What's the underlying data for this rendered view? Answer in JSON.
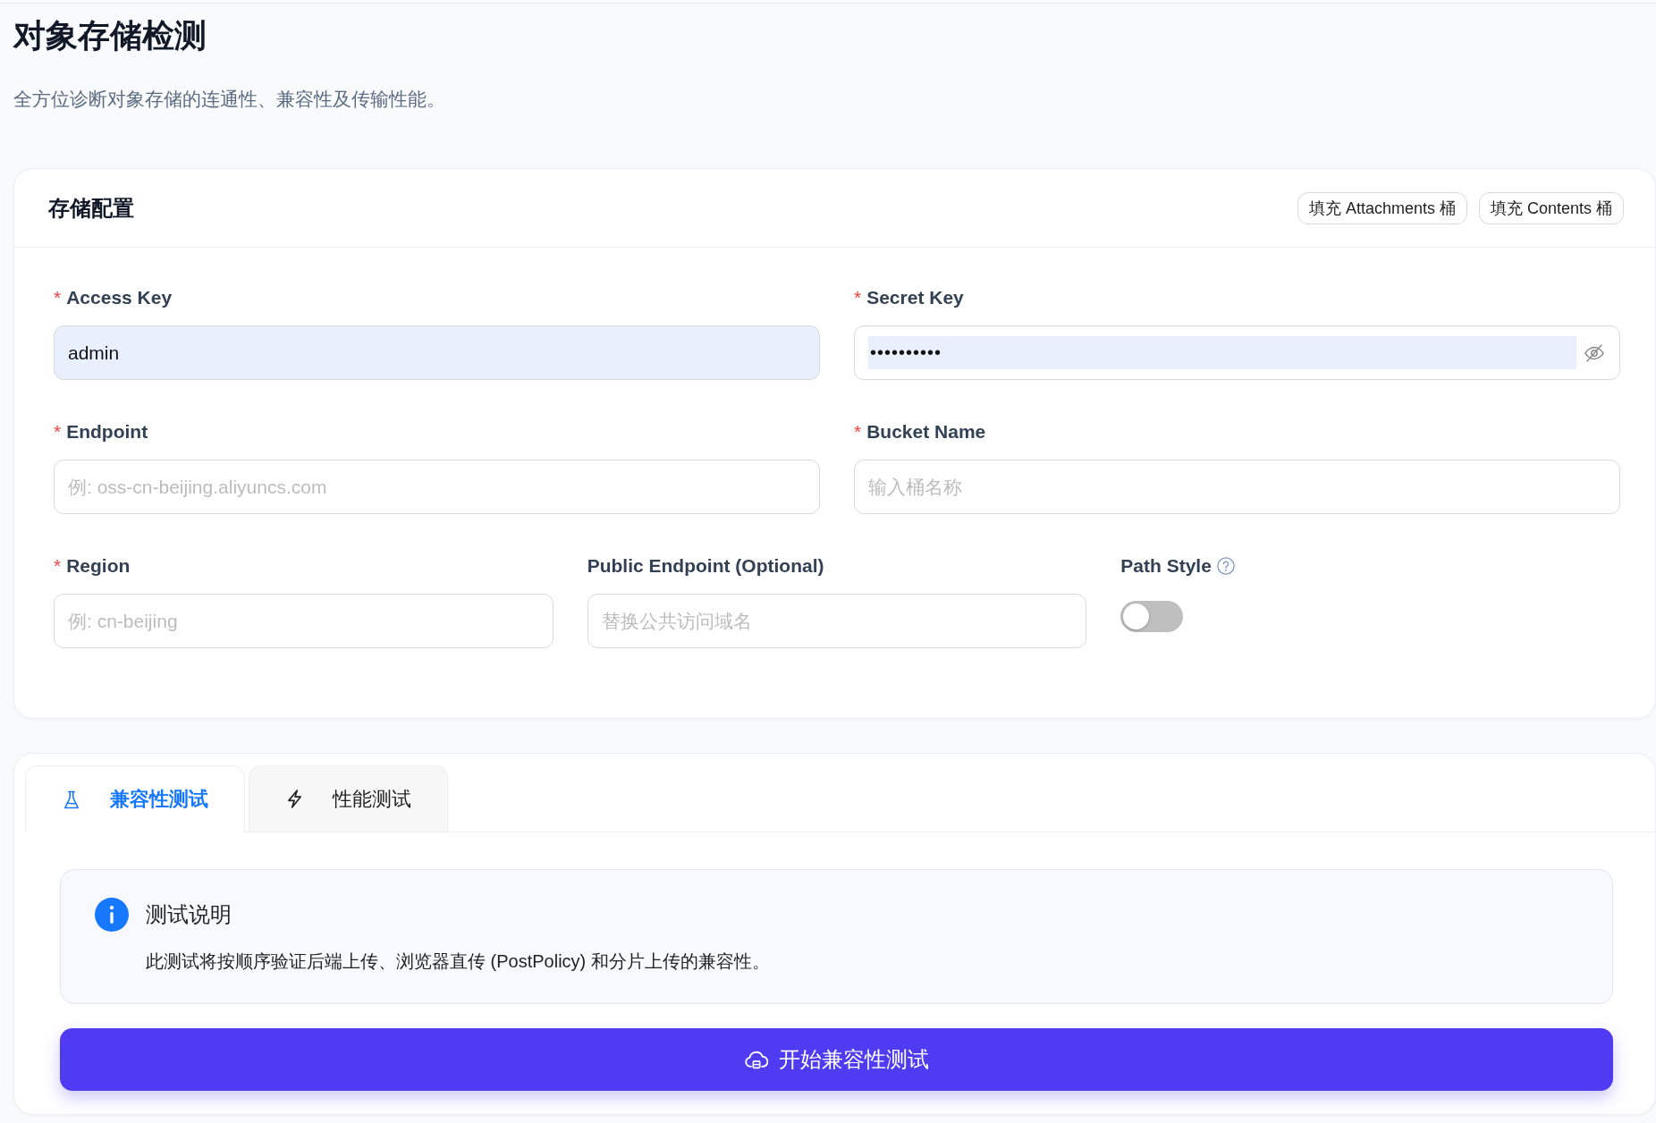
{
  "header": {
    "title": "对象存储检测",
    "subtitle": "全方位诊断对象存储的连通性、兼容性及传输性能。"
  },
  "storage_config": {
    "title": "存储配置",
    "actions": [
      {
        "label": "填充 Attachments 桶"
      },
      {
        "label": "填充 Contents 桶"
      }
    ],
    "rows": [
      {
        "fields": [
          {
            "kind": "text",
            "required_mark": "*",
            "label": "Access Key",
            "help": false,
            "value": "admin",
            "autofilled": true
          },
          {
            "kind": "password",
            "required_mark": "*",
            "label": "Secret Key",
            "help": false,
            "value": "••••••••••",
            "autofilled": true
          }
        ]
      },
      {
        "fields": [
          {
            "kind": "text",
            "required_mark": "*",
            "label": "Endpoint",
            "help": false,
            "placeholder": "例: oss-cn-beijing.aliyuncs.com",
            "autofilled": false
          },
          {
            "kind": "text",
            "required_mark": "*",
            "label": "Bucket Name",
            "help": false,
            "placeholder": "输入桶名称",
            "autofilled": false
          }
        ]
      },
      {
        "fields": [
          {
            "kind": "text",
            "required_mark": "*",
            "label": "Region",
            "help": false,
            "placeholder": "例: cn-beijing",
            "autofilled": false
          },
          {
            "kind": "text",
            "label": "Public Endpoint (Optional)",
            "help": false,
            "placeholder": "替换公共访问域名",
            "autofilled": false
          },
          {
            "kind": "switch",
            "label": "Path Style",
            "help": true,
            "on": false
          }
        ]
      }
    ]
  },
  "tabs": [
    {
      "label": "兼容性测试",
      "selected": true
    },
    {
      "label": "性能测试",
      "selected": false
    }
  ],
  "notice": {
    "title": "测试说明",
    "text": "此测试将按顺序验证后端上传、浏览器直传 (PostPolicy) 和分片上传的兼容性。"
  },
  "primary_button": {
    "label": "开始兼容性测试"
  }
}
